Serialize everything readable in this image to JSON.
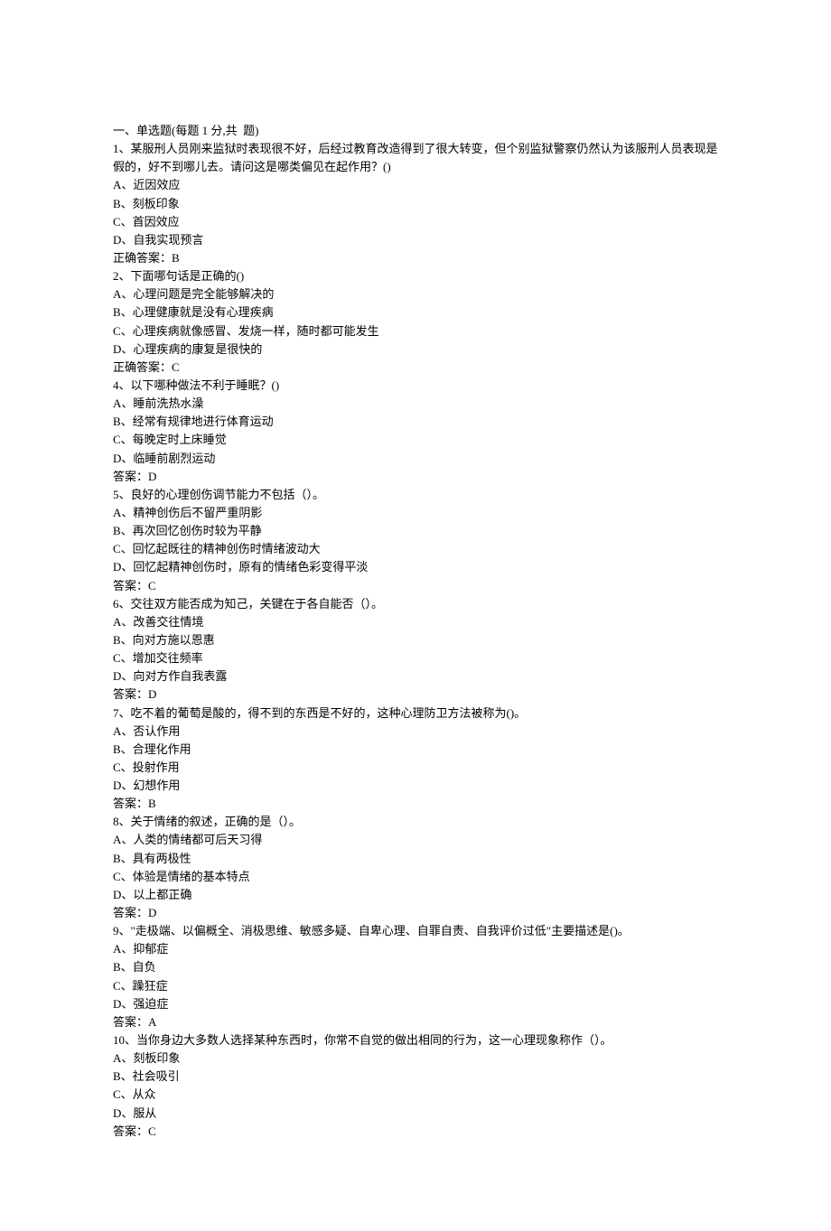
{
  "header": "一、单选题(每题 1 分,共  题)",
  "questions": [
    {
      "num": "1",
      "stem": "某服刑人员刚来监狱时表现很不好，后经过教育改造得到了很大转变，但个别监狱警察仍然认为该服刑人员表现是假的，好不到哪儿去。请问这是哪类偏见在起作用？()",
      "options": [
        {
          "label": "A",
          "text": "近因效应"
        },
        {
          "label": "B",
          "text": "刻板印象"
        },
        {
          "label": "C",
          "text": "首因效应"
        },
        {
          "label": "D",
          "text": "自我实现预言"
        }
      ],
      "answerLabel": "正确答案：",
      "answer": "B"
    },
    {
      "num": "2",
      "stem": "下面哪句话是正确的()",
      "options": [
        {
          "label": "A",
          "text": "心理问题是完全能够解决的"
        },
        {
          "label": "B",
          "text": "心理健康就是没有心理疾病"
        },
        {
          "label": "C",
          "text": "心理疾病就像感冒、发烧一样，随时都可能发生"
        },
        {
          "label": "D",
          "text": "心理疾病的康复是很快的"
        }
      ],
      "answerLabel": "正确答案：",
      "answer": "C"
    },
    {
      "num": "4",
      "stem": "以下哪种做法不利于睡眠？()",
      "options": [
        {
          "label": "A",
          "text": "睡前洗热水澡"
        },
        {
          "label": "B",
          "text": "经常有规律地进行体育运动"
        },
        {
          "label": "C",
          "text": "每晚定时上床睡觉"
        },
        {
          "label": "D",
          "text": "临睡前剧烈运动"
        }
      ],
      "answerLabel": "答案：",
      "answer": "D"
    },
    {
      "num": "5",
      "stem": "良好的心理创伤调节能力不包括（）。",
      "options": [
        {
          "label": "A",
          "text": "精神创伤后不留严重阴影"
        },
        {
          "label": "B",
          "text": "再次回忆创伤时较为平静"
        },
        {
          "label": "C",
          "text": "回忆起既往的精神创伤时情绪波动大"
        },
        {
          "label": "D",
          "text": "回忆起精神创伤时，原有的情绪色彩变得平淡"
        }
      ],
      "answerLabel": "答案：",
      "answer": "C"
    },
    {
      "num": "6",
      "stem": "交往双方能否成为知己，关键在于各自能否（）。",
      "options": [
        {
          "label": "A",
          "text": "改善交往情境"
        },
        {
          "label": "B",
          "text": "向对方施以恩惠"
        },
        {
          "label": "C",
          "text": "增加交往频率"
        },
        {
          "label": "D",
          "text": "向对方作自我表露"
        }
      ],
      "answerLabel": "答案：",
      "answer": "D"
    },
    {
      "num": "7",
      "stem": "吃不着的葡萄是酸的，得不到的东西是不好的，这种心理防卫方法被称为()。",
      "options": [
        {
          "label": "A",
          "text": "否认作用"
        },
        {
          "label": "B",
          "text": "合理化作用"
        },
        {
          "label": "C",
          "text": "投射作用"
        },
        {
          "label": "D",
          "text": "幻想作用"
        }
      ],
      "answerLabel": "答案：",
      "answer": "B"
    },
    {
      "num": "8",
      "stem": "关于情绪的叙述，正确的是（）。",
      "options": [
        {
          "label": "A",
          "text": "人类的情绪都可后天习得"
        },
        {
          "label": "B",
          "text": "具有两极性"
        },
        {
          "label": "C",
          "text": "体验是情绪的基本特点"
        },
        {
          "label": "D",
          "text": "以上都正确"
        }
      ],
      "answerLabel": "答案：",
      "answer": "D"
    },
    {
      "num": "9",
      "stem": "\"走极端、以偏概全、消极思维、敏感多疑、自卑心理、自罪自责、自我评价过低\"主要描述是()。",
      "options": [
        {
          "label": "A",
          "text": "抑郁症"
        },
        {
          "label": "B",
          "text": "自负"
        },
        {
          "label": "C",
          "text": "躁狂症"
        },
        {
          "label": "D",
          "text": "强迫症"
        }
      ],
      "answerLabel": "答案：",
      "answer": "A"
    },
    {
      "num": "10",
      "stem": "当你身边大多数人选择某种东西时，你常不自觉的做出相同的行为，这一心理现象称作（）。",
      "options": [
        {
          "label": "A",
          "text": "刻板印象"
        },
        {
          "label": "B",
          "text": "社会吸引"
        },
        {
          "label": "C",
          "text": "从众"
        },
        {
          "label": "D",
          "text": "服从"
        }
      ],
      "answerLabel": "答案：",
      "answer": "C"
    }
  ]
}
